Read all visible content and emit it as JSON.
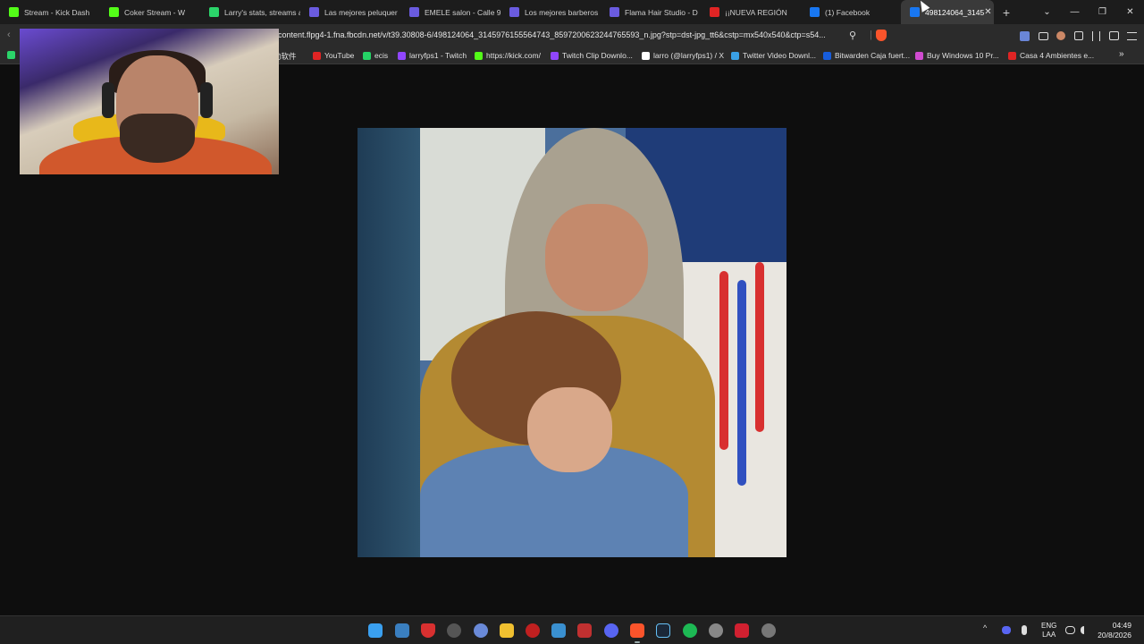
{
  "tabs": [
    {
      "title": "Stream - Kick Dash",
      "color": "#53fc18"
    },
    {
      "title": "Coker Stream - W",
      "color": "#53fc18"
    },
    {
      "title": "Larry's stats, streams a",
      "color": "#2bd46a"
    },
    {
      "title": "Las mejores peluquer",
      "color": "#6a5be0"
    },
    {
      "title": "EMELE salon - Calle 9",
      "color": "#6a5be0"
    },
    {
      "title": "Los mejores barberos",
      "color": "#6a5be0"
    },
    {
      "title": "Flama Hair Studio - D",
      "color": "#6a5be0"
    },
    {
      "title": "¡¡NUEVA REGIÓN",
      "color": "#e02424"
    },
    {
      "title": "(1) Facebook",
      "color": "#1877f2"
    },
    {
      "title": "498124064_3145",
      "color": "#1877f2",
      "active": true
    }
  ],
  "address": {
    "url": "content.flpg4-1.fna.fbcdn.net/v/t39.30808-6/498124064_3145976155564743_8597200623244765593_n.jpg?stp=dst-jpg_tt6&cstp=mx540x540&ctp=s54..."
  },
  "bookmarks": [
    {
      "label": "动软件",
      "color": "#888"
    },
    {
      "label": "YouTube",
      "color": "#e02424"
    },
    {
      "label": "ecis",
      "color": "#25d366"
    },
    {
      "label": "larryfps1 - Twitch",
      "color": "#9146ff"
    },
    {
      "label": "https://kick.com/",
      "color": "#53fc18"
    },
    {
      "label": "Twitch Clip Downlo...",
      "color": "#9146ff"
    },
    {
      "label": "larro (@larryfps1) / X",
      "color": "#ffffff"
    },
    {
      "label": "Twitter Video Downl...",
      "color": "#3aa0e6"
    },
    {
      "label": "Bitwarden Caja fuert...",
      "color": "#175ddc"
    },
    {
      "label": "Buy Windows 10 Pr...",
      "color": "#d04bd0"
    },
    {
      "label": "Casa 4 Ambientes e...",
      "color": "#e02424"
    }
  ],
  "taskbar": {
    "language": [
      "ENG",
      "LAA"
    ],
    "time": "04:49",
    "date": "20/8/2026"
  },
  "window_controls": {
    "minimize": "—",
    "restore": "❐",
    "close": "✕"
  },
  "icons": {
    "new_tab": "+",
    "tab_list": "⌄",
    "back": "‹",
    "zoom": "⚲",
    "bookmarks_more": "»"
  }
}
